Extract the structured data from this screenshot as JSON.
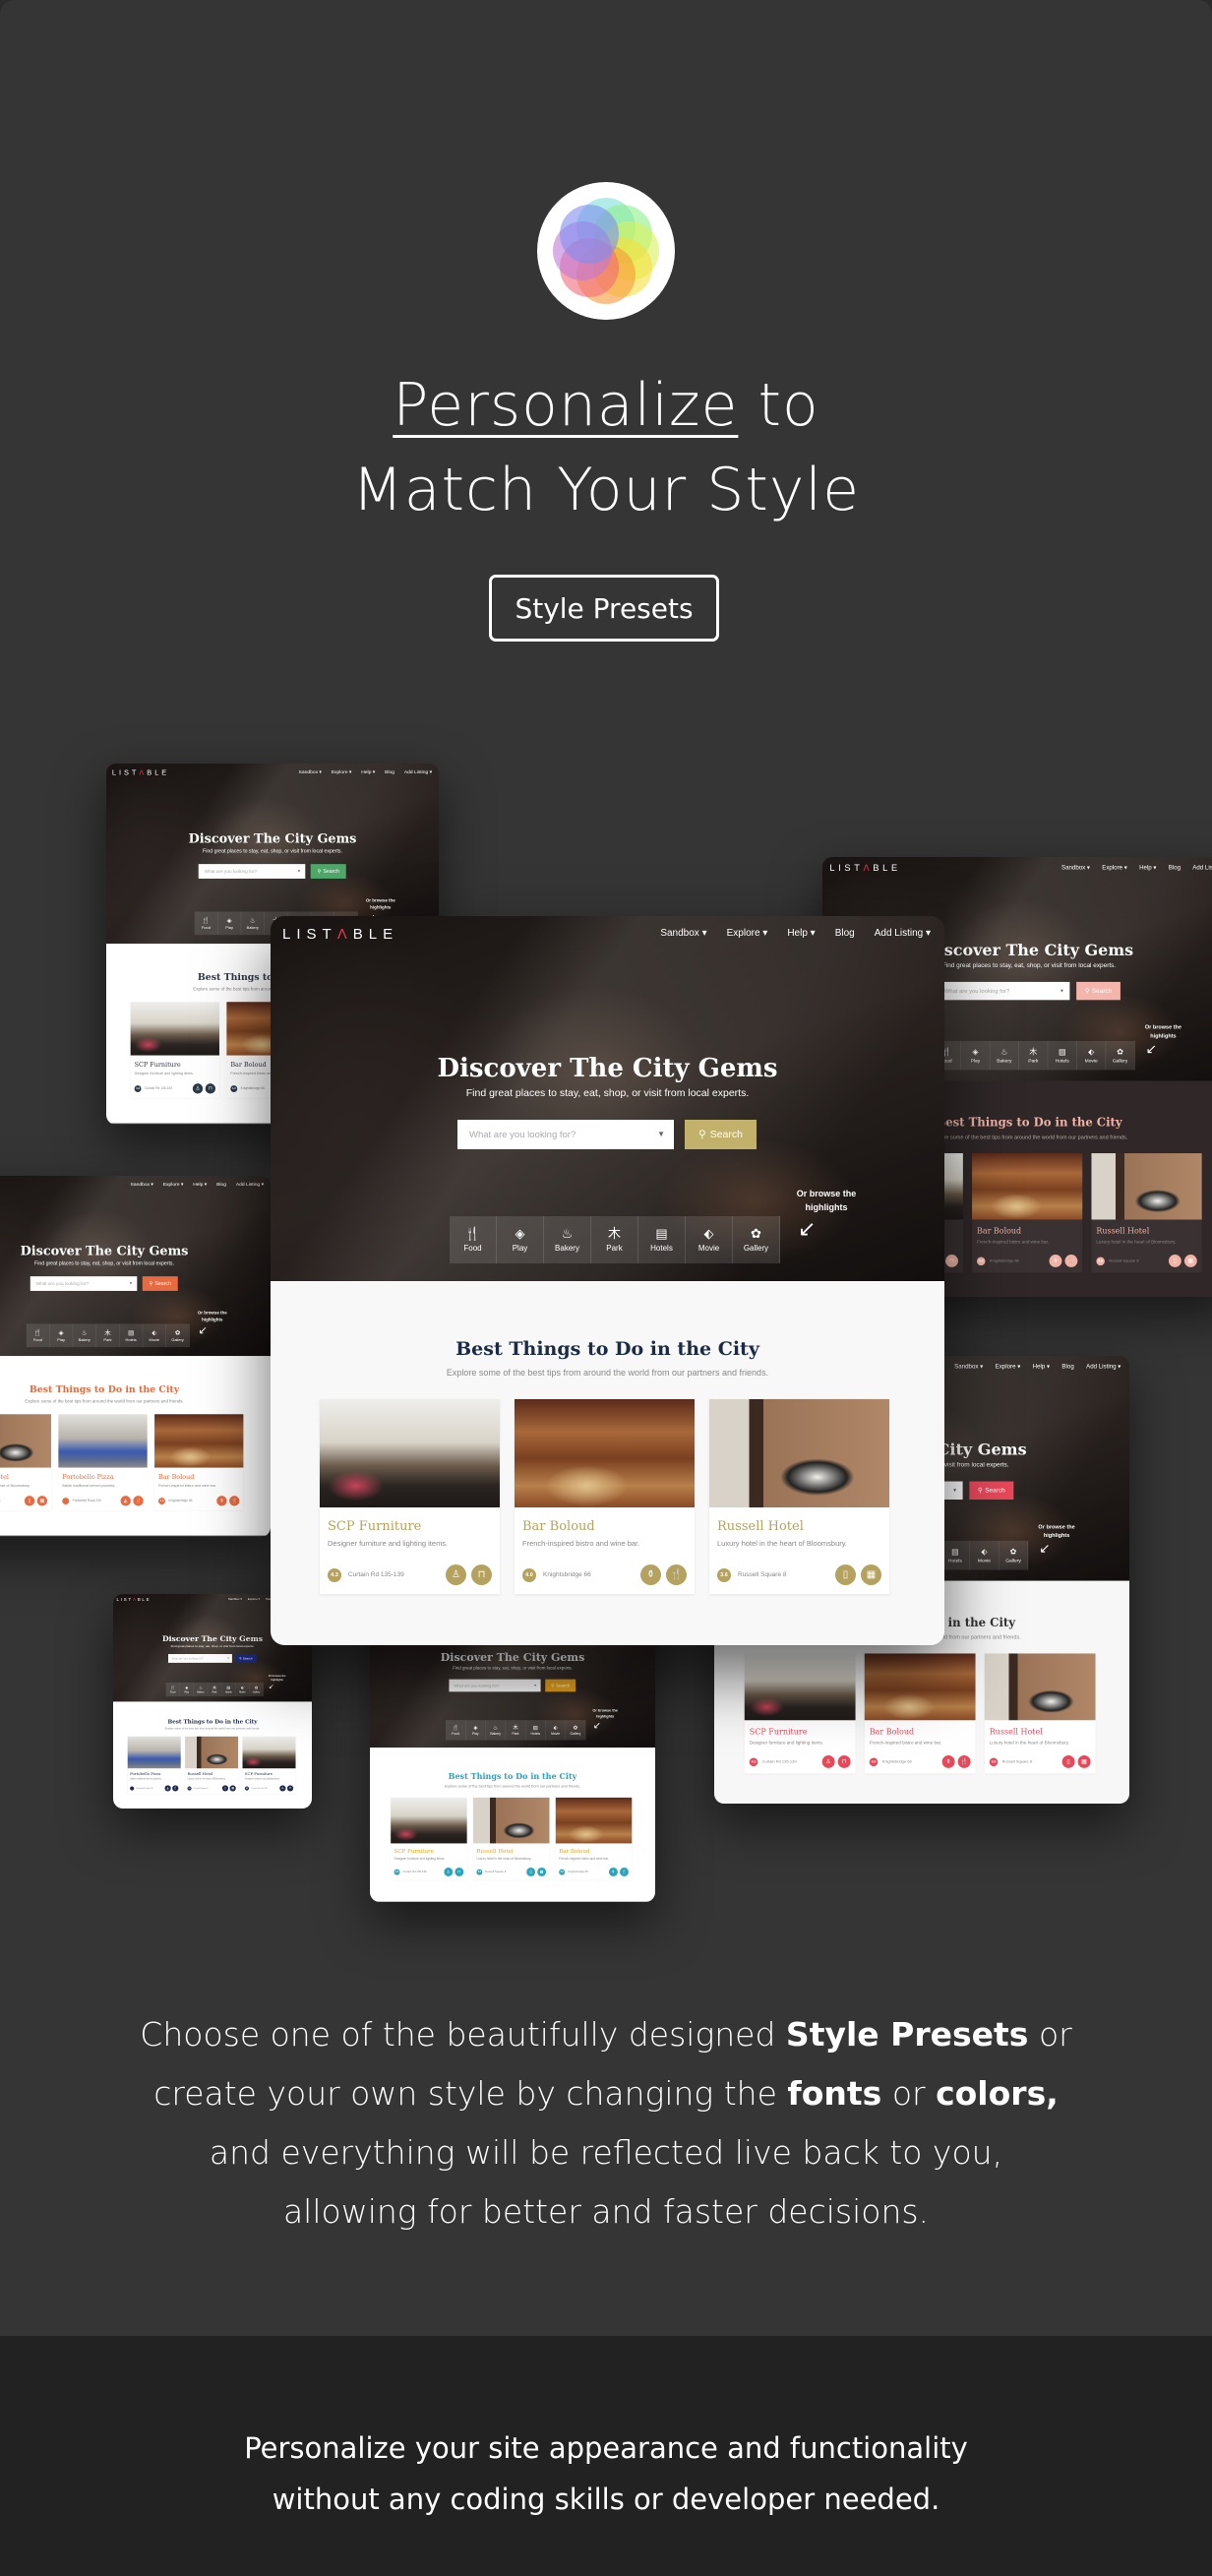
{
  "header": {
    "logo_icon": "color-wheel-icon",
    "title_underlined": "Personalize",
    "title_rest": " to",
    "title_line2": "Match Your Style",
    "button_label": "Style Presets"
  },
  "showcase": {
    "brand": {
      "pre": "LIST",
      "accent": "Λ",
      "post": "BLE"
    },
    "nav": [
      "Sandbox ▾",
      "Explore ▾",
      "Help ▾",
      "Blog",
      "Add Listing ▾"
    ],
    "hero_title": "Discover The City Gems",
    "hero_subtitle": "Find great places to stay, eat, shop, or visit from local experts.",
    "search_placeholder": "What are you looking for?",
    "search_button": "Search",
    "browse_hint": "Or browse the highlights",
    "categories": [
      {
        "label": "Food",
        "icon": "fork-spoon-icon"
      },
      {
        "label": "Play",
        "icon": "ticket-icon"
      },
      {
        "label": "Bakery",
        "icon": "cupcake-icon"
      },
      {
        "label": "Park",
        "icon": "tree-icon"
      },
      {
        "label": "Hotels",
        "icon": "bed-icon"
      },
      {
        "label": "Movie",
        "icon": "film-ticket-icon"
      },
      {
        "label": "Gallery",
        "icon": "palette-icon"
      }
    ],
    "section_title": "Best Things to Do in the City",
    "section_subtitle": "Explore some of the best tips from around the world from our partners and friends.",
    "listings": {
      "scp": {
        "title": "SCP Furniture",
        "desc": "Designer furniture and lighting items.",
        "rating": "4.3",
        "address": "Curtain Rd 135-139",
        "icons": [
          "chair-icon",
          "shopping-bag-icon"
        ]
      },
      "bar": {
        "title": "Bar Boloud",
        "desc": "French-inspired bistro and wine bar.",
        "rating": "4.0",
        "address": "Knightsbridge 66",
        "icons": [
          "wine-bottle-icon",
          "fork-spoon-icon"
        ]
      },
      "russell": {
        "title": "Russell Hotel",
        "desc": "Luxury hotel in the heart of Bloomsbury.",
        "rating": "3.6",
        "address": "Russell Square 8",
        "icons": [
          "door-icon",
          "hotel-icon"
        ]
      },
      "pizza": {
        "title": "Portobello Pizza",
        "desc": "Italian traditional served pizzeria.",
        "rating": "",
        "address": "Portobello Road 310",
        "icons": [
          "pizza-icon",
          "fork-spoon-icon"
        ]
      }
    },
    "presets": [
      {
        "id": "green",
        "accent": "#4fa86a",
        "heading": "#2b3a4a",
        "title": "#2b3a4a",
        "lower": "#ffffff",
        "card": "#ffffff",
        "listings": [
          "scp",
          "bar",
          "russell"
        ]
      },
      {
        "id": "dark-pink",
        "accent": "#f4b5ad",
        "heading": "#f0b3a6",
        "title": "#f0b3a6",
        "lower": "#2f2728",
        "card": "#3a3132",
        "listings": [
          "scp",
          "bar",
          "russell"
        ]
      },
      {
        "id": "orange",
        "accent": "#e86a40",
        "heading": "#e86a40",
        "title": "#e86a40",
        "lower": "#ffffff",
        "card": "#ffffff",
        "listings": [
          "russell",
          "pizza",
          "bar"
        ]
      },
      {
        "id": "red",
        "accent": "#e8485a",
        "heading": "#333333",
        "title": "#e8485a",
        "lower": "#f7f7f7",
        "card": "#ffffff",
        "listings": [
          "scp",
          "bar",
          "russell"
        ]
      },
      {
        "id": "navy",
        "accent": "#1e2a80",
        "heading": "#1e2a50",
        "title": "#1e2a50",
        "lower": "#ffffff",
        "card": "#ffffff",
        "listings": [
          "pizza",
          "russell",
          "scp"
        ]
      },
      {
        "id": "teal-amber",
        "accent": "#e6a21a",
        "heading": "#2aa3bd",
        "title": "#e6a21a",
        "icon": "#2aa3bd",
        "lower": "#ffffff",
        "card": "#ffffff",
        "listings": [
          "scp",
          "russell",
          "bar"
        ]
      },
      {
        "id": "gold",
        "accent": "#c2b16b",
        "heading": "#1b2b45",
        "title": "#b5a25e",
        "lower": "#f8f8f8",
        "card": "#ffffff",
        "listings": [
          "scp",
          "bar",
          "russell"
        ]
      }
    ]
  },
  "description": [
    [
      {
        "t": "Choose one of the beautifully designed "
      },
      {
        "t": "Style Presets",
        "b": true
      },
      {
        "t": " or"
      }
    ],
    [
      {
        "t": "create your own style by changing the "
      },
      {
        "t": "fonts",
        "b": true
      },
      {
        "t": " or "
      },
      {
        "t": "colors,",
        "b": true
      }
    ],
    [
      {
        "t": "and everything will be reflected live back to you,"
      }
    ],
    [
      {
        "t": "allowing for better and faster decisions."
      }
    ]
  ],
  "footer": {
    "line1": "Personalize your site appearance and functionality",
    "line2": "without any coding skills or developer needed."
  }
}
